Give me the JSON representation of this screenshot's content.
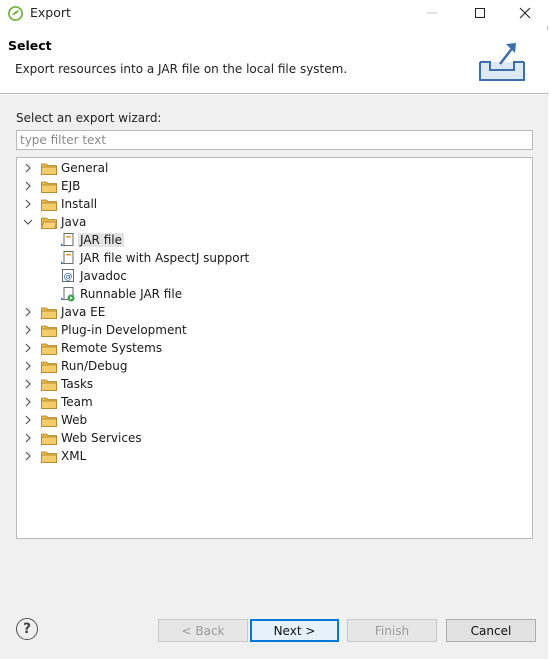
{
  "window": {
    "title": "Export"
  },
  "banner": {
    "title": "Select",
    "description": "Export resources into a JAR file on the local file system."
  },
  "wizard": {
    "label": "Select an export wizard:",
    "filter_placeholder": "type filter text"
  },
  "tree": {
    "items": [
      {
        "label": "General",
        "type": "folder",
        "expanded": false,
        "level": 0
      },
      {
        "label": "EJB",
        "type": "folder",
        "expanded": false,
        "level": 0
      },
      {
        "label": "Install",
        "type": "folder",
        "expanded": false,
        "level": 0
      },
      {
        "label": "Java",
        "type": "folder",
        "expanded": true,
        "level": 0
      },
      {
        "label": "JAR file",
        "type": "jar",
        "level": 1,
        "selected": true
      },
      {
        "label": "JAR file with AspectJ support",
        "type": "jar",
        "level": 1
      },
      {
        "label": "Javadoc",
        "type": "javadoc",
        "level": 1
      },
      {
        "label": "Runnable JAR file",
        "type": "runnable-jar",
        "level": 1
      },
      {
        "label": "Java EE",
        "type": "folder",
        "expanded": false,
        "level": 0
      },
      {
        "label": "Plug-in Development",
        "type": "folder",
        "expanded": false,
        "level": 0
      },
      {
        "label": "Remote Systems",
        "type": "folder",
        "expanded": false,
        "level": 0
      },
      {
        "label": "Run/Debug",
        "type": "folder",
        "expanded": false,
        "level": 0
      },
      {
        "label": "Tasks",
        "type": "folder",
        "expanded": false,
        "level": 0
      },
      {
        "label": "Team",
        "type": "folder",
        "expanded": false,
        "level": 0
      },
      {
        "label": "Web",
        "type": "folder",
        "expanded": false,
        "level": 0
      },
      {
        "label": "Web Services",
        "type": "folder",
        "expanded": false,
        "level": 0
      },
      {
        "label": "XML",
        "type": "folder",
        "expanded": false,
        "level": 0
      }
    ]
  },
  "buttons": {
    "back": "< Back",
    "next": "Next >",
    "finish": "Finish",
    "cancel": "Cancel",
    "help": "?"
  },
  "colors": {
    "folder": "#e8b84a",
    "selection": "#e3e3e3",
    "default_button_border": "#0078d7",
    "dialog_bg": "#f0f0f0"
  }
}
